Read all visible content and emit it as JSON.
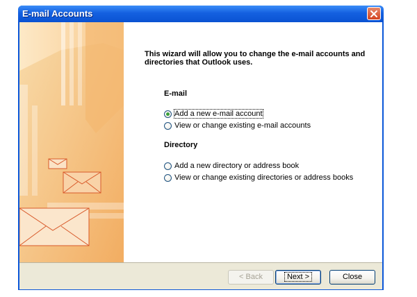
{
  "window": {
    "title": "E-mail Accounts",
    "close_icon": "close-icon"
  },
  "wizard": {
    "intro": "This wizard will allow you to change the e-mail accounts and directories that Outlook uses.",
    "email_section": {
      "heading": "E-mail",
      "options": [
        {
          "label": "Add a new e-mail account",
          "checked": true
        },
        {
          "label": "View or change existing e-mail accounts",
          "checked": false
        }
      ]
    },
    "directory_section": {
      "heading": "Directory",
      "options": [
        {
          "label": "Add a new directory or address book",
          "checked": false
        },
        {
          "label": "View or change existing directories or address books",
          "checked": false
        }
      ]
    }
  },
  "buttons": {
    "back": "< Back",
    "next": "Next >",
    "close": "Close"
  },
  "colors": {
    "titlebar": "#0a56d8",
    "footer": "#ece9d8",
    "art_orange": "#f2b868"
  }
}
